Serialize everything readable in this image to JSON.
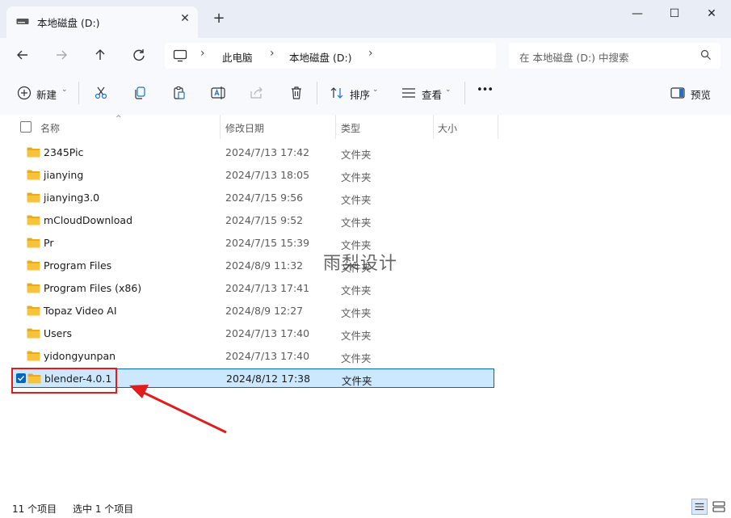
{
  "tab": {
    "title": "本地磁盘 (D:)",
    "close": "✕",
    "new": "+"
  },
  "window": {
    "minimize": "—",
    "maximize": "☐",
    "close": "✕"
  },
  "nav": {
    "breadcrumbs": [
      "此电脑",
      "本地磁盘 (D:)"
    ],
    "search_placeholder": "在 本地磁盘 (D:) 中搜索"
  },
  "commands": {
    "new_label": "新建",
    "sort_label": "排序",
    "view_label": "查看",
    "more": "•••",
    "preview_label": "预览"
  },
  "columns": [
    "名称",
    "修改日期",
    "类型",
    "大小"
  ],
  "files": [
    {
      "name": "2345Pic",
      "date": "2024/7/13 17:42",
      "type": "文件夹"
    },
    {
      "name": "jianying",
      "date": "2024/7/13 18:05",
      "type": "文件夹"
    },
    {
      "name": "jianying3.0",
      "date": "2024/7/15 9:56",
      "type": "文件夹"
    },
    {
      "name": "mCloudDownload",
      "date": "2024/7/15 9:52",
      "type": "文件夹"
    },
    {
      "name": "Pr",
      "date": "2024/7/15 15:39",
      "type": "文件夹"
    },
    {
      "name": "Program Files",
      "date": "2024/8/9 11:32",
      "type": "文件夹"
    },
    {
      "name": "Program Files (x86)",
      "date": "2024/7/13 17:41",
      "type": "文件夹"
    },
    {
      "name": "Topaz Video AI",
      "date": "2024/8/9 12:27",
      "type": "文件夹"
    },
    {
      "name": "Users",
      "date": "2024/7/13 17:40",
      "type": "文件夹"
    },
    {
      "name": "yidongyunpan",
      "date": "2024/7/13 17:40",
      "type": "文件夹"
    },
    {
      "name": "blender-4.0.1",
      "date": "2024/8/12 17:38",
      "type": "文件夹"
    }
  ],
  "selected_index": 10,
  "watermark": "雨梨设计",
  "status": {
    "count": "11 个项目",
    "selection": "选中 1 个项目"
  },
  "colors": {
    "accent": "#0067c0",
    "selection_bg": "#cce8ff",
    "annotation": "#e21b1b",
    "folder": "#f8c33a"
  }
}
